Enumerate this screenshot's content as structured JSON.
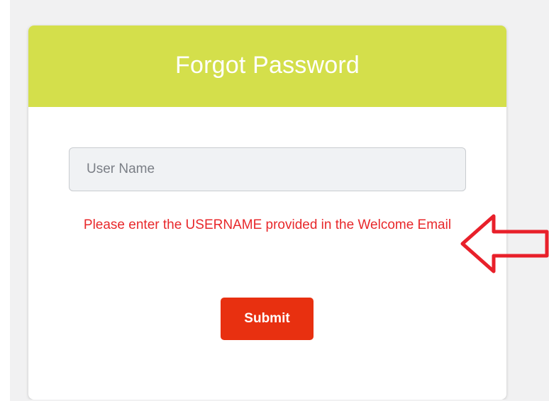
{
  "form": {
    "title": "Forgot Password",
    "username_placeholder": "User Name",
    "username_value": "",
    "help_text": "Please enter the USERNAME provided in the Welcome Email",
    "submit_label": "Submit"
  },
  "annotation": {
    "icon": "left-arrow-outline-icon"
  },
  "colors": {
    "header": "#d4df4b",
    "submit": "#e83010",
    "help_text": "#e8282b",
    "annotation": "#e8202a"
  }
}
